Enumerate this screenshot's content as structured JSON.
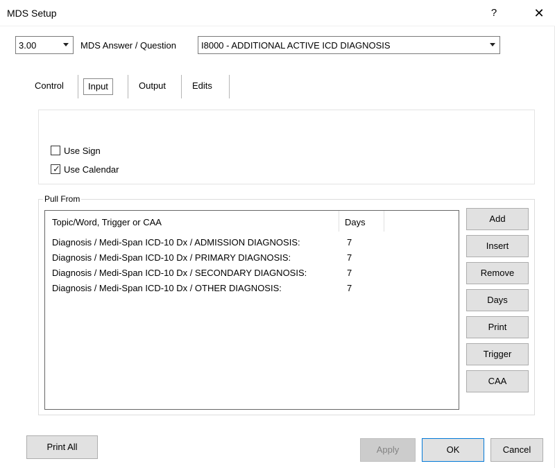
{
  "window": {
    "title": "MDS Setup",
    "help_label": "?",
    "close_label": "✕"
  },
  "header": {
    "version_value": "3.00",
    "question_label": "MDS Answer / Question",
    "question_value": "I8000 - ADDITIONAL ACTIVE ICD DIAGNOSIS"
  },
  "tabs": [
    {
      "label": "Control",
      "selected": false
    },
    {
      "label": "Input",
      "selected": true
    },
    {
      "label": "Output",
      "selected": false
    },
    {
      "label": "Edits",
      "selected": false
    }
  ],
  "options": {
    "use_sign": {
      "label": "Use Sign",
      "checked": false
    },
    "use_calendar": {
      "label": "Use Calendar",
      "checked": true
    }
  },
  "pull_from": {
    "group_label": "Pull From",
    "columns": [
      "Topic/Word, Trigger or CAA",
      "Days"
    ],
    "rows": [
      {
        "topic": "Diagnosis / Medi-Span ICD-10 Dx / ADMISSION DIAGNOSIS:",
        "days": "7"
      },
      {
        "topic": "Diagnosis / Medi-Span ICD-10 Dx / PRIMARY DIAGNOSIS:",
        "days": "7"
      },
      {
        "topic": "Diagnosis / Medi-Span ICD-10 Dx / SECONDARY DIAGNOSIS:",
        "days": "7"
      },
      {
        "topic": "Diagnosis / Medi-Span ICD-10 Dx / OTHER DIAGNOSIS:",
        "days": "7"
      }
    ]
  },
  "side_buttons": {
    "add": "Add",
    "insert": "Insert",
    "remove": "Remove",
    "days": "Days",
    "print": "Print",
    "trigger": "Trigger",
    "caa": "CAA"
  },
  "footer": {
    "print_all": "Print All",
    "apply": "Apply",
    "ok": "OK",
    "cancel": "Cancel"
  },
  "colors": {
    "button_face": "#e1e1e1",
    "default_button_border": "#0078d7",
    "disabled_text": "#838383"
  }
}
